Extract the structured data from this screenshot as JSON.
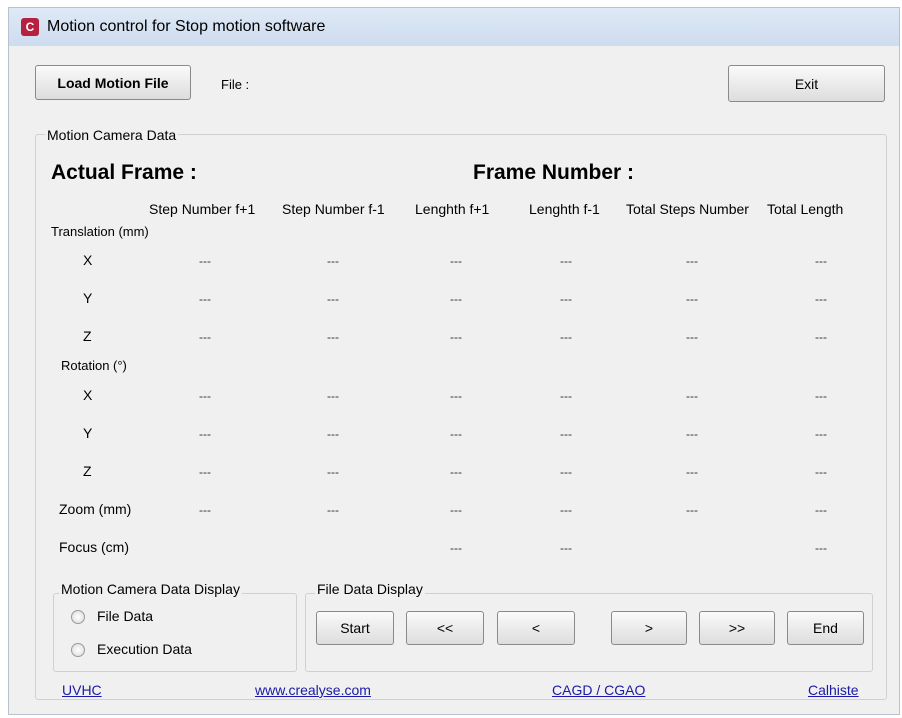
{
  "window": {
    "title": "Motion control for Stop motion software"
  },
  "toolbar": {
    "load_label": "Load Motion File",
    "file_label": "File :",
    "file_value": "",
    "exit_label": "Exit"
  },
  "camera": {
    "group_title": "Motion Camera Data",
    "actual_frame_label": "Actual Frame :",
    "frame_number_label": "Frame Number :",
    "columns": [
      "Step Number f+1",
      "Step Number f-1",
      "Lenghth f+1",
      "Lenghth f-1",
      "Total Steps Number",
      "Total Length"
    ],
    "sections": {
      "translation": "Translation (mm)",
      "rotation": "Rotation (°)"
    },
    "rows": [
      {
        "label": "X",
        "values": [
          "---",
          "---",
          "---",
          "---",
          "---",
          "---"
        ]
      },
      {
        "label": "Y",
        "values": [
          "---",
          "---",
          "---",
          "---",
          "---",
          "---"
        ]
      },
      {
        "label": "Z",
        "values": [
          "---",
          "---",
          "---",
          "---",
          "---",
          "---"
        ]
      },
      {
        "label": "X",
        "values": [
          "---",
          "---",
          "---",
          "---",
          "---",
          "---"
        ]
      },
      {
        "label": "Y",
        "values": [
          "---",
          "---",
          "---",
          "---",
          "---",
          "---"
        ]
      },
      {
        "label": "Z",
        "values": [
          "---",
          "---",
          "---",
          "---",
          "---",
          "---"
        ]
      },
      {
        "label": "Zoom (mm)",
        "values": [
          "---",
          "---",
          "---",
          "---",
          "---",
          "---"
        ]
      },
      {
        "label": "Focus (cm)",
        "values": [
          "",
          "",
          "---",
          "---",
          "",
          "---"
        ]
      }
    ]
  },
  "display": {
    "group_title": "Motion Camera Data Display",
    "file_data": "File Data",
    "execution_data": "Execution Data"
  },
  "file_display": {
    "group_title": "File Data Display",
    "start": "Start",
    "prev_fast": "<<",
    "prev": "<",
    "next": ">",
    "next_fast": ">>",
    "end": "End"
  },
  "footer": {
    "uvhc": "UVHC",
    "crealyse": "www.crealyse.com",
    "cagd": "CAGD / CGAO",
    "calhiste": "Calhiste"
  }
}
